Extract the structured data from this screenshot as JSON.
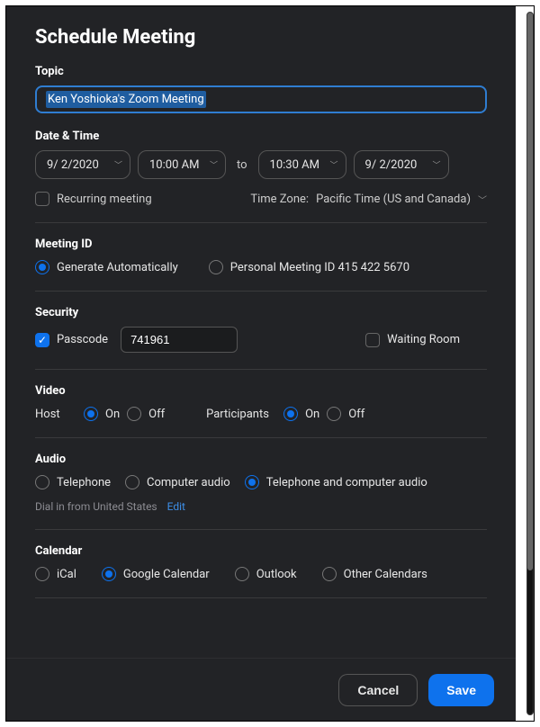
{
  "title": "Schedule Meeting",
  "topic": {
    "label": "Topic",
    "value": "Ken Yoshioka's Zoom Meeting"
  },
  "datetime": {
    "label": "Date & Time",
    "start_date": "9/ 2/2020",
    "start_time": "10:00 AM",
    "to": "to",
    "end_time": "10:30 AM",
    "end_date": "9/ 2/2020"
  },
  "recurring": {
    "label": "Recurring meeting",
    "checked": false
  },
  "timezone": {
    "label": "Time Zone:",
    "value": "Pacific Time (US and Canada)"
  },
  "meeting_id": {
    "label": "Meeting ID",
    "options": {
      "auto": "Generate Automatically",
      "personal": "Personal Meeting ID 415 422 5670"
    },
    "selected": "auto"
  },
  "security": {
    "label": "Security",
    "passcode_label": "Passcode",
    "passcode_value": "741961",
    "passcode_checked": true,
    "waiting_label": "Waiting Room",
    "waiting_checked": false
  },
  "video": {
    "label": "Video",
    "host_label": "Host",
    "participants_label": "Participants",
    "on": "On",
    "off": "Off",
    "host_value": "on",
    "participants_value": "on"
  },
  "audio": {
    "label": "Audio",
    "options": {
      "tel": "Telephone",
      "comp": "Computer audio",
      "both": "Telephone and computer audio"
    },
    "selected": "both",
    "dial_in": "Dial in from United States",
    "edit": "Edit"
  },
  "calendar": {
    "label": "Calendar",
    "options": {
      "ical": "iCal",
      "google": "Google Calendar",
      "outlook": "Outlook",
      "other": "Other Calendars"
    },
    "selected": "google"
  },
  "buttons": {
    "cancel": "Cancel",
    "save": "Save"
  }
}
